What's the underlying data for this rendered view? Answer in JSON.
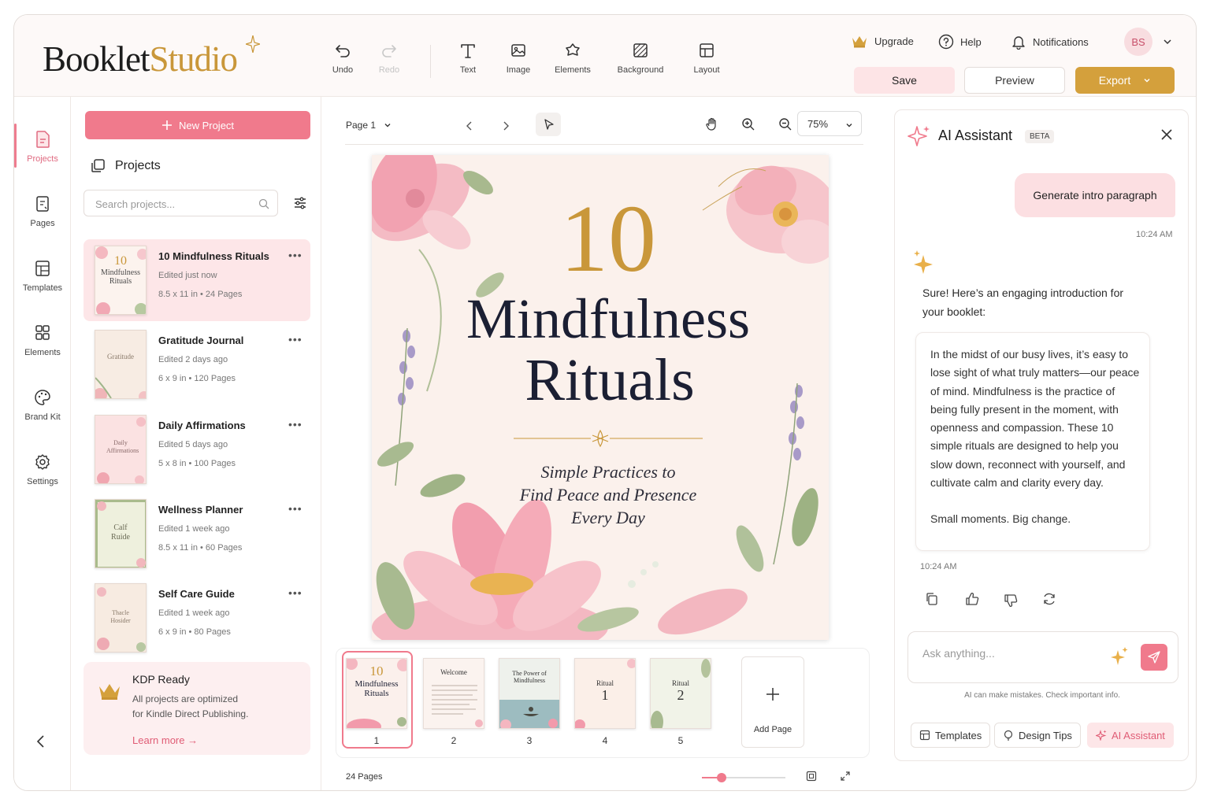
{
  "app": {
    "logo_part1": "Booklet",
    "logo_part2": "Studio"
  },
  "toolbar": {
    "undo": "Undo",
    "redo": "Redo",
    "text": "Text",
    "image": "Image",
    "elements": "Elements",
    "background": "Background",
    "layout": "Layout"
  },
  "header": {
    "upgrade": "Upgrade",
    "help": "Help",
    "notifications": "Notifications",
    "avatar": "BS",
    "save": "Save",
    "preview": "Preview",
    "export": "Export"
  },
  "rail": {
    "projects": "Projects",
    "pages": "Pages",
    "templates": "Templates",
    "elements": "Elements",
    "brand_kit": "Brand Kit",
    "settings": "Settings"
  },
  "projects_panel": {
    "new_project": "New Project",
    "title": "Projects",
    "search_placeholder": "Search projects...",
    "items": [
      {
        "title": "10 Mindfulness Rituals",
        "edited": "Edited just now",
        "meta": "8.5 x 11 in  •  24 Pages",
        "thumb": "10 Mindfulness Rituals"
      },
      {
        "title": "Gratitude Journal",
        "edited": "Edited 2 days ago",
        "meta": "6 x 9 in  •  120 Pages",
        "thumb": "Gratitude"
      },
      {
        "title": "Daily Affirmations",
        "edited": "Edited 5 days ago",
        "meta": "5 x 8 in  •  100 Pages",
        "thumb": "Daily Affirmations"
      },
      {
        "title": "Wellness Planner",
        "edited": "Edited 1 week ago",
        "meta": "8.5 x 11 in  •  60 Pages",
        "thumb": "Calf Ruide"
      },
      {
        "title": "Self Care Guide",
        "edited": "Edited 1 week ago",
        "meta": "6 x 9 in  •  80 Pages",
        "thumb": "Thacle Hosider"
      }
    ],
    "kdp": {
      "title": "KDP Ready",
      "desc1": "All projects are optimized",
      "desc2": "for Kindle Direct Publishing.",
      "link": "Learn more"
    }
  },
  "canvas": {
    "page_select": "Page 1",
    "zoom": "75%",
    "cover": {
      "number": "10",
      "title1": "Mindfulness",
      "title2": "Rituals",
      "sub1": "Simple Practices to",
      "sub2": "Find Peace and Presence",
      "sub3": "Every Day"
    },
    "thumbs": [
      {
        "num": "1",
        "label": "10 Mindfulness Rituals"
      },
      {
        "num": "2",
        "label": "Welcome"
      },
      {
        "num": "3",
        "label": "The Power of Mindfulness"
      },
      {
        "num": "4",
        "label": "Ritual",
        "big": "1"
      },
      {
        "num": "5",
        "label": "Ritual",
        "big": "2"
      }
    ],
    "add_page": "Add Page",
    "page_count": "24 Pages",
    "zoom_slider_level": 0.24
  },
  "ai": {
    "title": "AI Assistant",
    "badge": "BETA",
    "user_msg": "Generate intro paragraph",
    "user_time": "10:24 AM",
    "reply_intro": "Sure! Here’s an engaging introduction for your booklet:",
    "reply_body": "In the midst of our busy lives, it’s easy to lose sight of what truly matters—our peace of mind. Mindfulness is the practice of being fully present in the moment, with openness and compassion. These 10 simple rituals are designed to help you slow down, reconnect with yourself, and cultivate calm and clarity every day.",
    "reply_tagline": "Small moments. Big change.",
    "reply_time": "10:24 AM",
    "input_placeholder": "Ask anything...",
    "disclaimer": "AI can make mistakes. Check important info.",
    "chips": {
      "templates": "Templates",
      "design_tips": "Design Tips",
      "ai_assistant": "AI Assistant"
    }
  },
  "colors": {
    "accent_pink": "#f07a8c",
    "gold": "#c9973a",
    "export_gold": "#d4a03c"
  }
}
